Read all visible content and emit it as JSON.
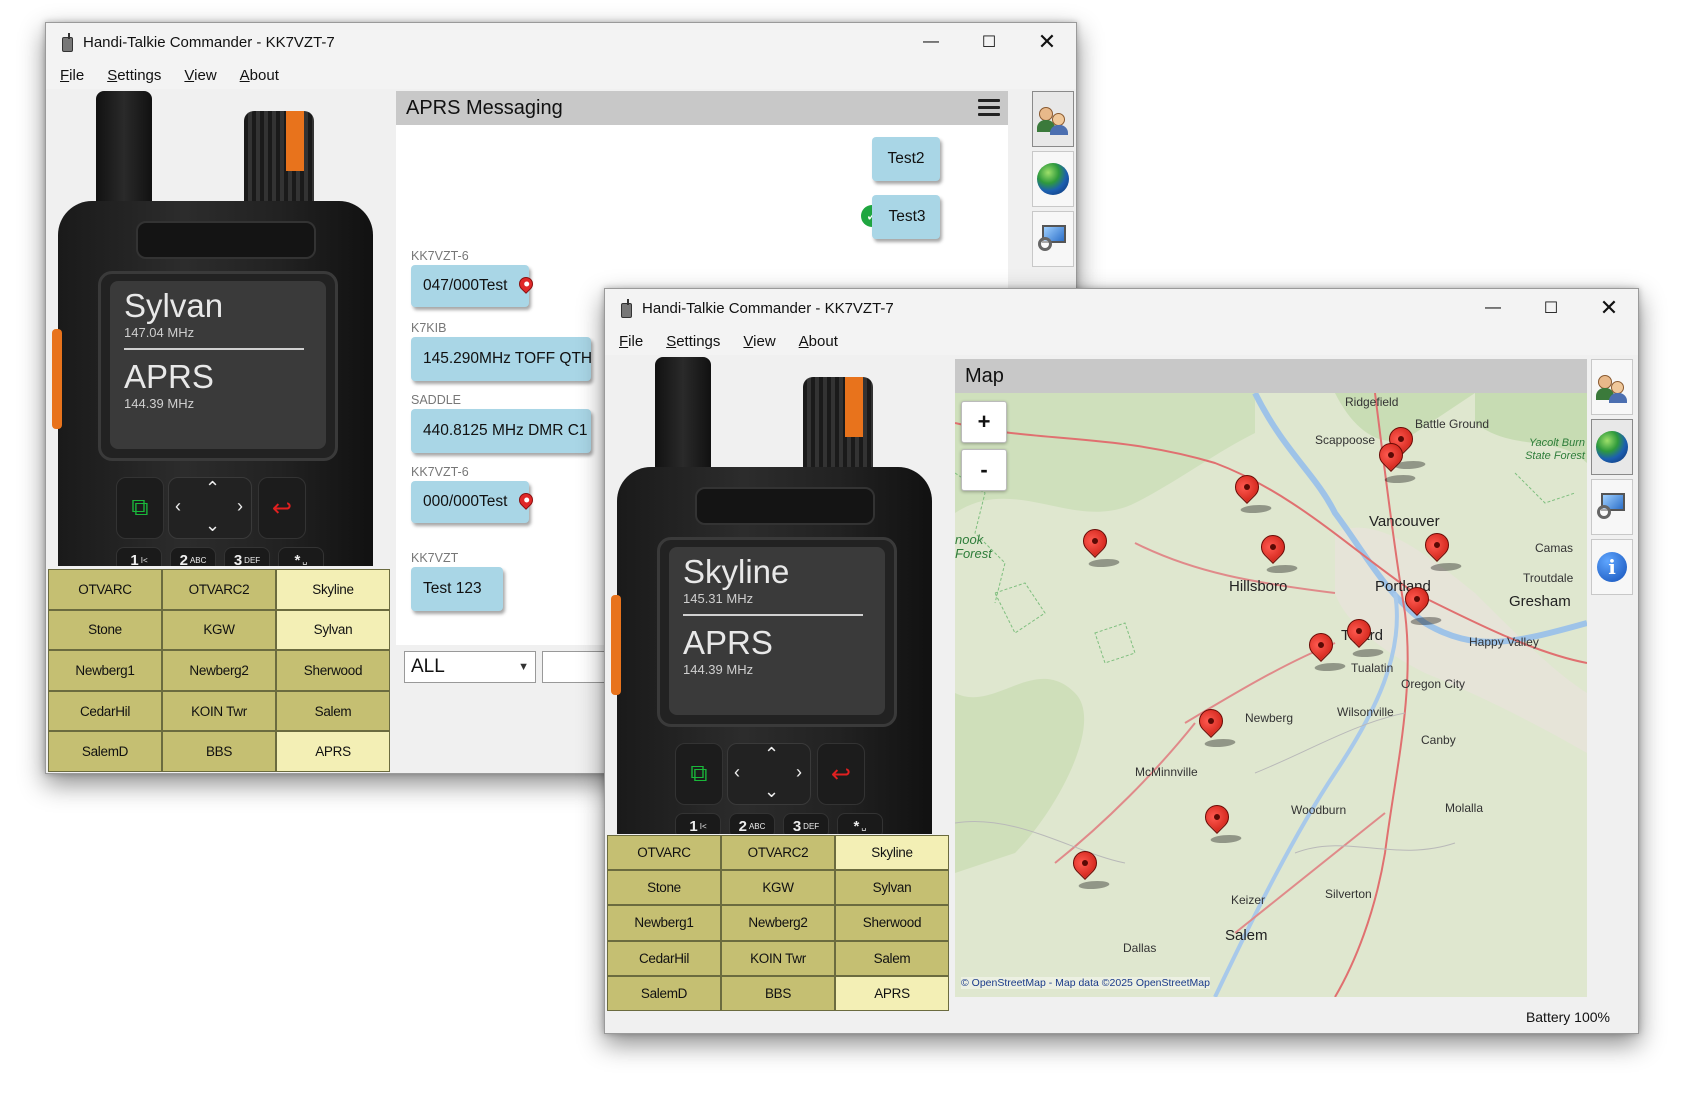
{
  "window_back": {
    "title": "Handi-Talkie Commander - KK7VZT-7",
    "controls": {
      "minimize": "—",
      "maximize": "☐",
      "close": "✕"
    },
    "menu": [
      {
        "label": "File",
        "u": "F",
        "rest": "ile"
      },
      {
        "label": "Settings",
        "u": "S",
        "rest": "ettings"
      },
      {
        "label": "View",
        "u": "V",
        "rest": "iew"
      },
      {
        "label": "About",
        "u": "A",
        "rest": "bout"
      }
    ],
    "radio": {
      "channel_name": "Sylvan",
      "channel_freq": "147.04 MHz",
      "second_name": "APRS",
      "second_freq": "144.39 MHz"
    },
    "keypad": [
      "1",
      "2",
      "3",
      "*"
    ],
    "keypad_sub": [
      "I<",
      "ABC",
      "DEF",
      "␣"
    ],
    "channels": [
      "OTVARC",
      "OTVARC2",
      "Skyline",
      "Stone",
      "KGW",
      "Sylvan",
      "Newberg1",
      "Newberg2",
      "Sherwood",
      "CedarHil",
      "KOIN Twr",
      "Salem",
      "SalemD",
      "BBS",
      "APRS"
    ],
    "selected_channels": [
      "Skyline",
      "Sylvan",
      "APRS"
    ],
    "messaging": {
      "title": "APRS Messaging",
      "outgoing": [
        "Test2",
        "Test3"
      ],
      "incoming": [
        {
          "sender": "KK7VZT-6",
          "text": "047/000Test"
        },
        {
          "sender": "K7KIB",
          "text": "145.290MHz TOFF QTH"
        },
        {
          "sender": "SADDLE",
          "text": "440.8125 MHz DMR C1"
        },
        {
          "sender": "KK7VZT-6",
          "text": "000/000Test"
        },
        {
          "sender": "KK7VZT",
          "text": "Test 123"
        }
      ],
      "filter_value": "ALL"
    }
  },
  "window_front": {
    "title": "Handi-Talkie Commander - KK7VZT-7",
    "controls": {
      "minimize": "—",
      "maximize": "☐",
      "close": "✕"
    },
    "menu": [
      {
        "label": "File",
        "u": "F",
        "rest": "ile"
      },
      {
        "label": "Settings",
        "u": "S",
        "rest": "ettings"
      },
      {
        "label": "View",
        "u": "V",
        "rest": "iew"
      },
      {
        "label": "About",
        "u": "A",
        "rest": "bout"
      }
    ],
    "radio": {
      "channel_name": "Skyline",
      "channel_freq": "145.31 MHz",
      "second_name": "APRS",
      "second_freq": "144.39 MHz"
    },
    "keypad": [
      "1",
      "2",
      "3",
      "*"
    ],
    "keypad_sub": [
      "I<",
      "ABC",
      "DEF",
      "␣"
    ],
    "channels": [
      "OTVARC",
      "OTVARC2",
      "Skyline",
      "Stone",
      "KGW",
      "Sylvan",
      "Newberg1",
      "Newberg2",
      "Sherwood",
      "CedarHil",
      "KOIN Twr",
      "Salem",
      "SalemD",
      "BBS",
      "APRS"
    ],
    "selected_channels": [
      "Skyline",
      "APRS"
    ],
    "map": {
      "title": "Map",
      "zoom_in": "+",
      "zoom_out": "-",
      "attribution": "© OpenStreetMap - Map data ©2025 OpenStreetMap",
      "places": {
        "ridgefield": "Ridgefield",
        "battle_ground": "Battle Ground",
        "scappoose": "Scappoose",
        "yacolt": "Yacolt Burn State Forest",
        "vancouver": "Vancouver",
        "camas": "Camas",
        "troutdale": "Troutdale",
        "hillsboro": "Hillsboro",
        "portland": "Portland",
        "gresham": "Gresham",
        "happy_valley": "Happy Valley",
        "tigard": "Tigard",
        "tualatin": "Tualatin",
        "oregon_city": "Oregon City",
        "wilsonville": "Wilsonville",
        "newberg": "Newberg",
        "canby": "Canby",
        "mcminnville": "McMinnville",
        "woodburn": "Woodburn",
        "molalla": "Molalla",
        "silverton": "Silverton",
        "keizer": "Keizer",
        "salem": "Salem",
        "dallas": "Dallas",
        "tillamook": "nook Forest"
      }
    },
    "status": "Battery 100%"
  },
  "icons": {
    "people": "people-icon",
    "globe": "globe-icon",
    "monitor": "monitor-search-icon",
    "info": "info-icon"
  },
  "colors": {
    "bubble": "#a9d6e6",
    "channel_button": "#c5bf72",
    "channel_selected": "#f3efb5",
    "marker": "#e02828"
  }
}
